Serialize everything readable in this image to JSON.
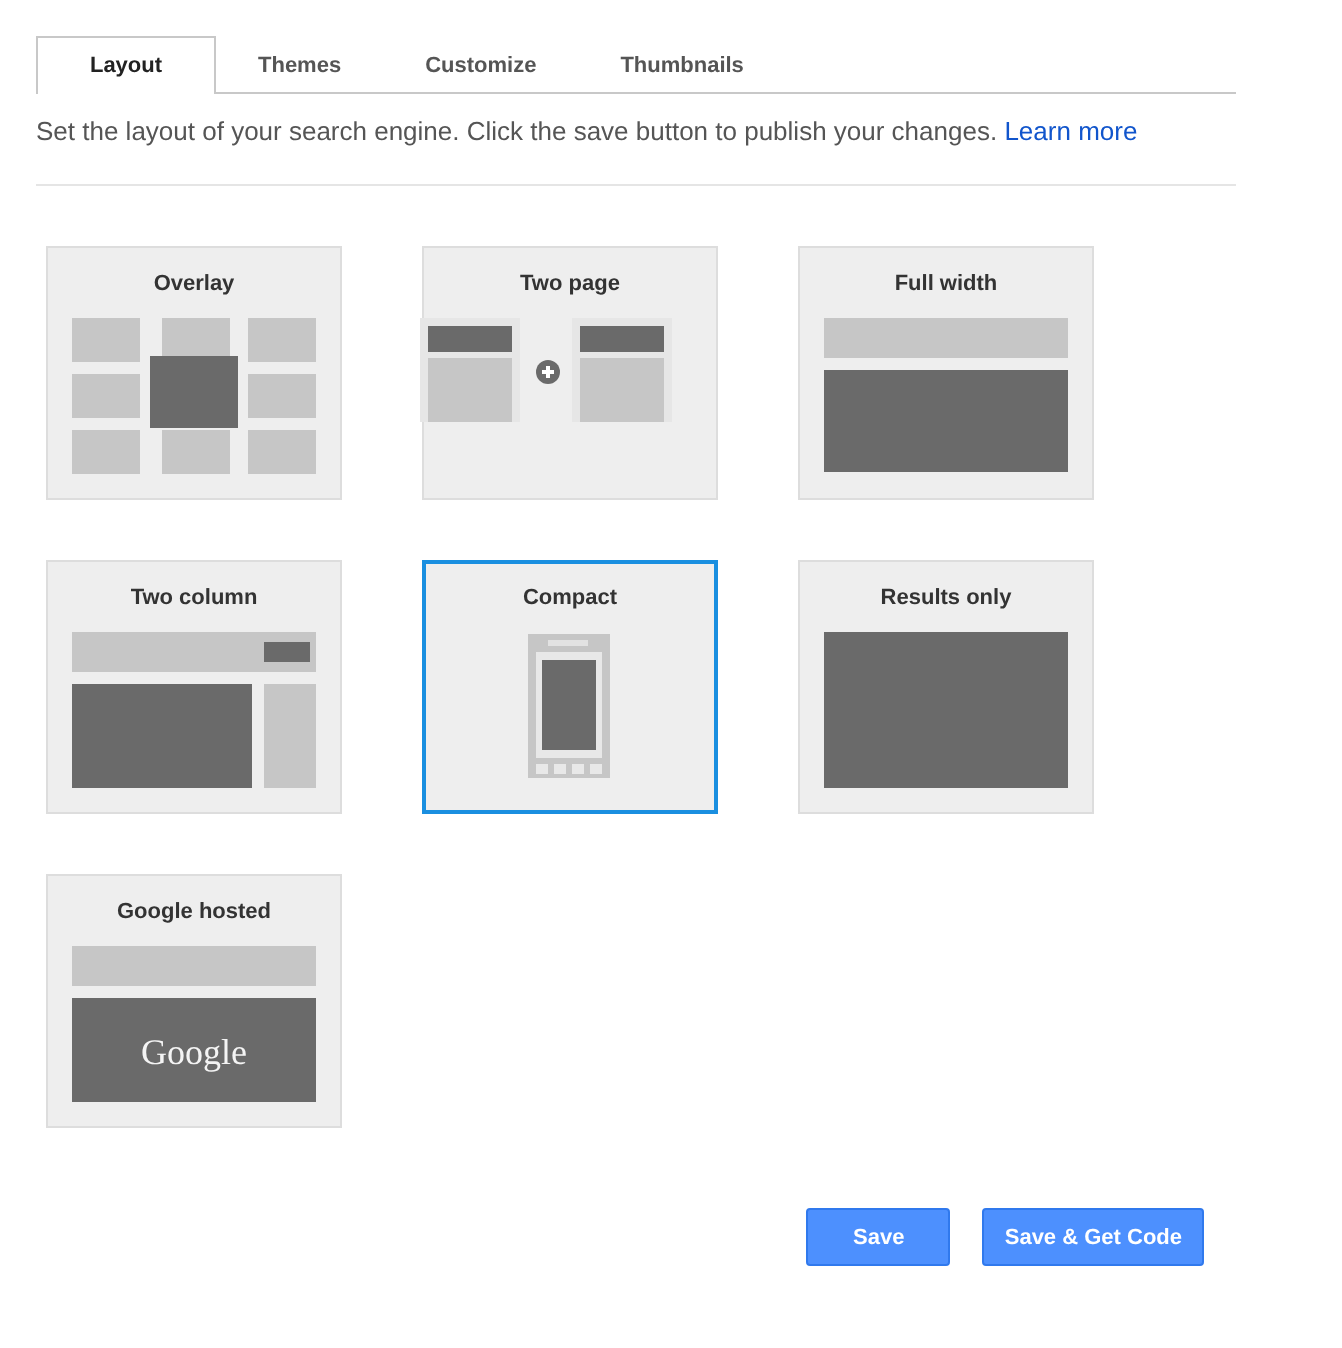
{
  "tabs": [
    {
      "label": "Layout",
      "selected": true
    },
    {
      "label": "Themes",
      "selected": false
    },
    {
      "label": "Customize",
      "selected": false
    },
    {
      "label": "Thumbnails",
      "selected": false
    }
  ],
  "description": {
    "text": "Set the layout of your search engine. Click the save button to publish your changes.",
    "link": "Learn more"
  },
  "layouts": [
    {
      "title": "Overlay",
      "kind": "overlay",
      "selected": false
    },
    {
      "title": "Two page",
      "kind": "two-page",
      "selected": false
    },
    {
      "title": "Full width",
      "kind": "full-width",
      "selected": false
    },
    {
      "title": "Two column",
      "kind": "two-column",
      "selected": false
    },
    {
      "title": "Compact",
      "kind": "compact",
      "selected": true
    },
    {
      "title": "Results only",
      "kind": "results-only",
      "selected": false
    },
    {
      "title": "Google hosted",
      "kind": "google-hosted",
      "selected": false,
      "logo_text": "Google"
    }
  ],
  "buttons": [
    {
      "label": "Save"
    },
    {
      "label": "Save & Get Code"
    }
  ]
}
